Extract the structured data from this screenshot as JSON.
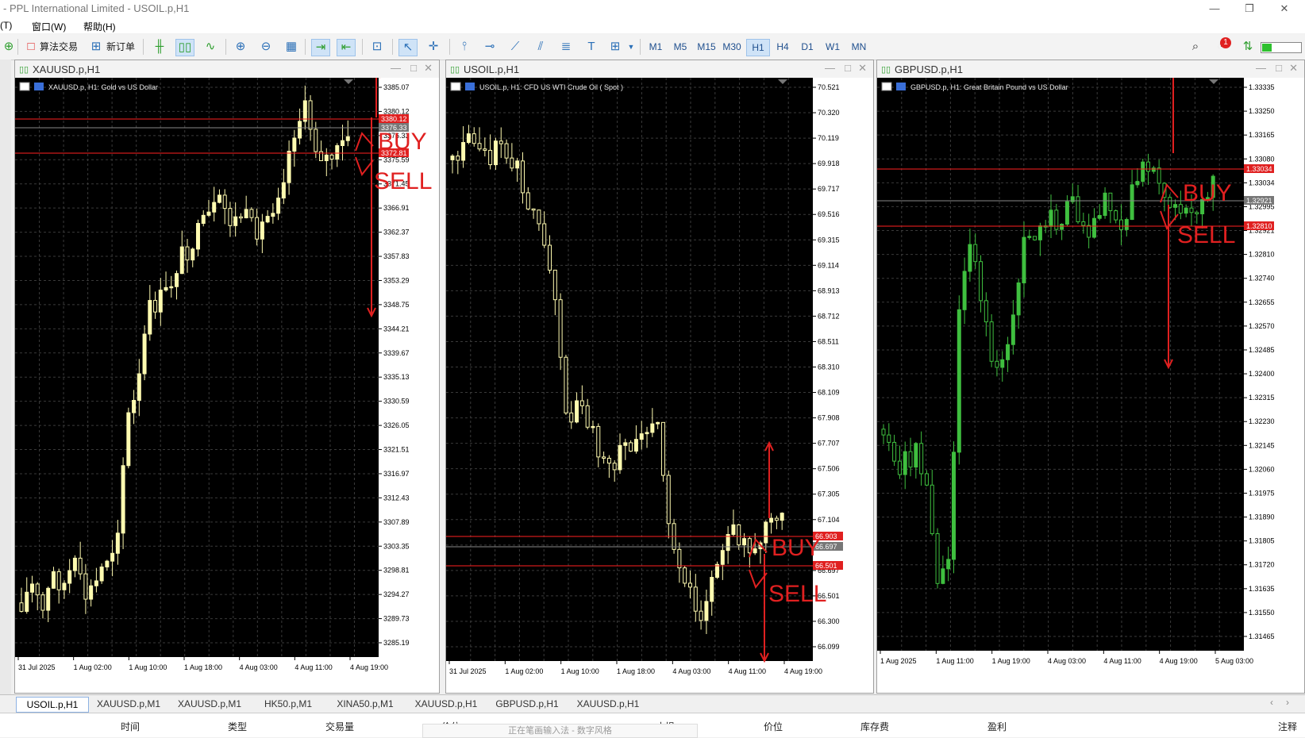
{
  "window": {
    "title": "- PPL International Limited - USOIL.p,H1",
    "controls": [
      "—",
      "❐",
      "✕"
    ]
  },
  "menu": [
    "(T)",
    "窗口(W)",
    "帮助(H)"
  ],
  "toolbar": {
    "algo_label": "算法交易",
    "new_order_label": "新订单",
    "timeframes": [
      "M1",
      "M5",
      "M15",
      "M30",
      "H1",
      "H4",
      "D1",
      "W1",
      "MN"
    ],
    "active_timeframe": "H1",
    "alert_count": "1"
  },
  "colors": {
    "bull": "#fffbb0",
    "bull_green": "#3fbf3f",
    "line": "#ff2020",
    "annot": "#e02020",
    "grid": "#3a3a3a"
  },
  "charts": [
    {
      "window_title": "XAUUSD.p,H1",
      "label": "XAUUSD.p, H1:  Gold vs US Dollar",
      "prices": [
        "3385.07",
        "3380.12",
        "3376.33",
        "3375.59",
        "3371.45",
        "3366.91",
        "3362.37",
        "3357.83",
        "3353.29",
        "3348.75",
        "3344.21",
        "3339.67",
        "3335.13",
        "3330.59",
        "3326.05",
        "3321.51",
        "3316.97",
        "3312.43",
        "3307.89",
        "3303.35",
        "3298.81",
        "3294.27",
        "3289.73",
        "3285.19"
      ],
      "times": [
        "31 Jul 2025",
        "1 Aug 02:00",
        "1 Aug 10:00",
        "1 Aug 18:00",
        "4 Aug 03:00",
        "4 Aug 11:00",
        "4 Aug 19:00"
      ],
      "buy_label": "BUY",
      "sell_label": "SELL"
    },
    {
      "window_title": "USOIL.p,H1",
      "label": "USOIL.p, H1:  CFD US WTI Crude Oil ( Spot )",
      "prices": [
        "70.521",
        "70.320",
        "70.119",
        "69.918",
        "69.717",
        "69.516",
        "69.315",
        "69.114",
        "68.913",
        "68.712",
        "68.511",
        "68.310",
        "68.109",
        "67.908",
        "67.707",
        "67.506",
        "67.305",
        "67.104",
        "66.903",
        "66.697",
        "66.501",
        "66.300",
        "66.099"
      ],
      "times": [
        "31 Jul 2025",
        "1 Aug 02:00",
        "1 Aug 10:00",
        "1 Aug 18:00",
        "4 Aug 03:00",
        "4 Aug 11:00",
        "4 Aug 19:00"
      ],
      "buy_label": "BUY",
      "sell_label": "SELL"
    },
    {
      "window_title": "GBPUSD.p,H1",
      "label": "GBPUSD.p, H1:  Great Britain Pound vs US Dollar",
      "prices": [
        "1.33335",
        "1.33250",
        "1.33165",
        "1.33080",
        "1.33034",
        "1.32995",
        "1.32921",
        "1.32810",
        "1.32740",
        "1.32655",
        "1.32570",
        "1.32485",
        "1.32400",
        "1.32315",
        "1.32230",
        "1.32145",
        "1.32060",
        "1.31975",
        "1.31890",
        "1.31805",
        "1.31720",
        "1.31635",
        "1.31550",
        "1.31465"
      ],
      "times": [
        "1 Aug 2025",
        "1 Aug 11:00",
        "1 Aug 19:00",
        "4 Aug 03:00",
        "4 Aug 11:00",
        "4 Aug 19:00",
        "5 Aug 03:00"
      ],
      "buy_label": "BUY",
      "sell_label": "SELL"
    }
  ],
  "bottom_tabs": [
    "USOIL.p,H1",
    "XAUUSD.p,M1",
    "XAUUSD.p,M1",
    "HK50.p,M1",
    "XINA50.p,M1",
    "XAUUSD.p,H1",
    "GBPUSD.p,H1",
    "XAUUSD.p,H1"
  ],
  "columns": [
    "时间",
    "类型",
    "交易量",
    "价位",
    "止损",
    "价位",
    "库存费",
    "盈利",
    "注释"
  ],
  "ime_text": "正在笔画输入法 - 数字风格"
}
